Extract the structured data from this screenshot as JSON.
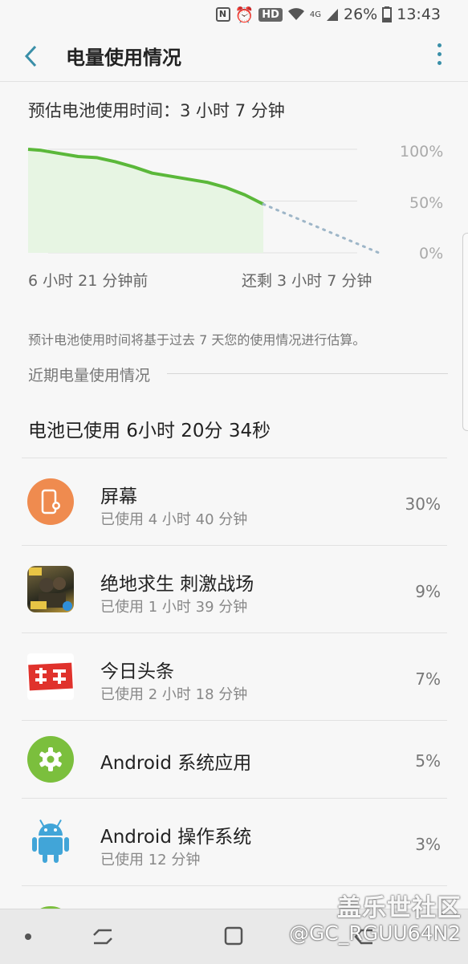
{
  "status_bar": {
    "battery": "26%",
    "time": "13:43",
    "hd": "HD",
    "network": "4G"
  },
  "header": {
    "title": "电量使用情况"
  },
  "estimate": {
    "label": "预估电池使用时间：3 小时 7 分钟"
  },
  "chart_data": {
    "type": "area",
    "ytick_labels": [
      "100%",
      "50%",
      "0%"
    ],
    "x_start_label": "6 小时 21 分钟前",
    "x_end_label": "还剩 3 小时 7 分钟",
    "ylim": [
      0,
      100
    ],
    "x_range_hours": [
      -6.35,
      3.12
    ],
    "series": [
      {
        "x": [
          -6.35,
          -6.0,
          -5.5,
          -5.0,
          -4.5,
          -4.0,
          -3.5,
          -3.0,
          -2.5,
          -2.0,
          -1.5,
          -1.0,
          -0.5,
          0.0
        ],
        "values": [
          100,
          99,
          96,
          93,
          92,
          88,
          83,
          77,
          74,
          71,
          68,
          63,
          56,
          47
        ]
      },
      {
        "style": "projected",
        "x": [
          0.0,
          3.12
        ],
        "values": [
          47,
          0
        ]
      }
    ],
    "colors": {
      "line": "#5bb83a",
      "fill": "#e7f5e3",
      "projected": "#9eb6c8"
    }
  },
  "note": "预计电池使用时间将基于过去 7 天您的使用情况进行估算。",
  "section_title": "近期电量使用情况",
  "total_used": "电池已使用 6小时 20分 34秒",
  "apps": [
    {
      "name": "屏幕",
      "usage": "已使用 4 小时 40 分钟",
      "percent": "30%",
      "icon": "screen-brightness-icon",
      "color": "#ef8b4f"
    },
    {
      "name": "绝地求生 刺激战场",
      "usage": "已使用 1 小时 39 分钟",
      "percent": "9%",
      "icon": "pubg-game-icon",
      "color": "#3b3b2a"
    },
    {
      "name": "今日头条",
      "usage": "已使用 2 小时 18 分钟",
      "percent": "7%",
      "icon": "toutiao-news-icon",
      "color": "#e0322c"
    },
    {
      "name": "Android 系统应用",
      "usage": "",
      "percent": "5%",
      "icon": "settings-gear-icon",
      "color": "#7bbf3d"
    },
    {
      "name": "Android 操作系统",
      "usage": "已使用 12 分钟",
      "percent": "3%",
      "icon": "android-robot-icon",
      "color": "#41a5d8"
    }
  ],
  "watermark": {
    "line1": "盖乐世社区",
    "line2": "@GC_RGUU64N2"
  }
}
